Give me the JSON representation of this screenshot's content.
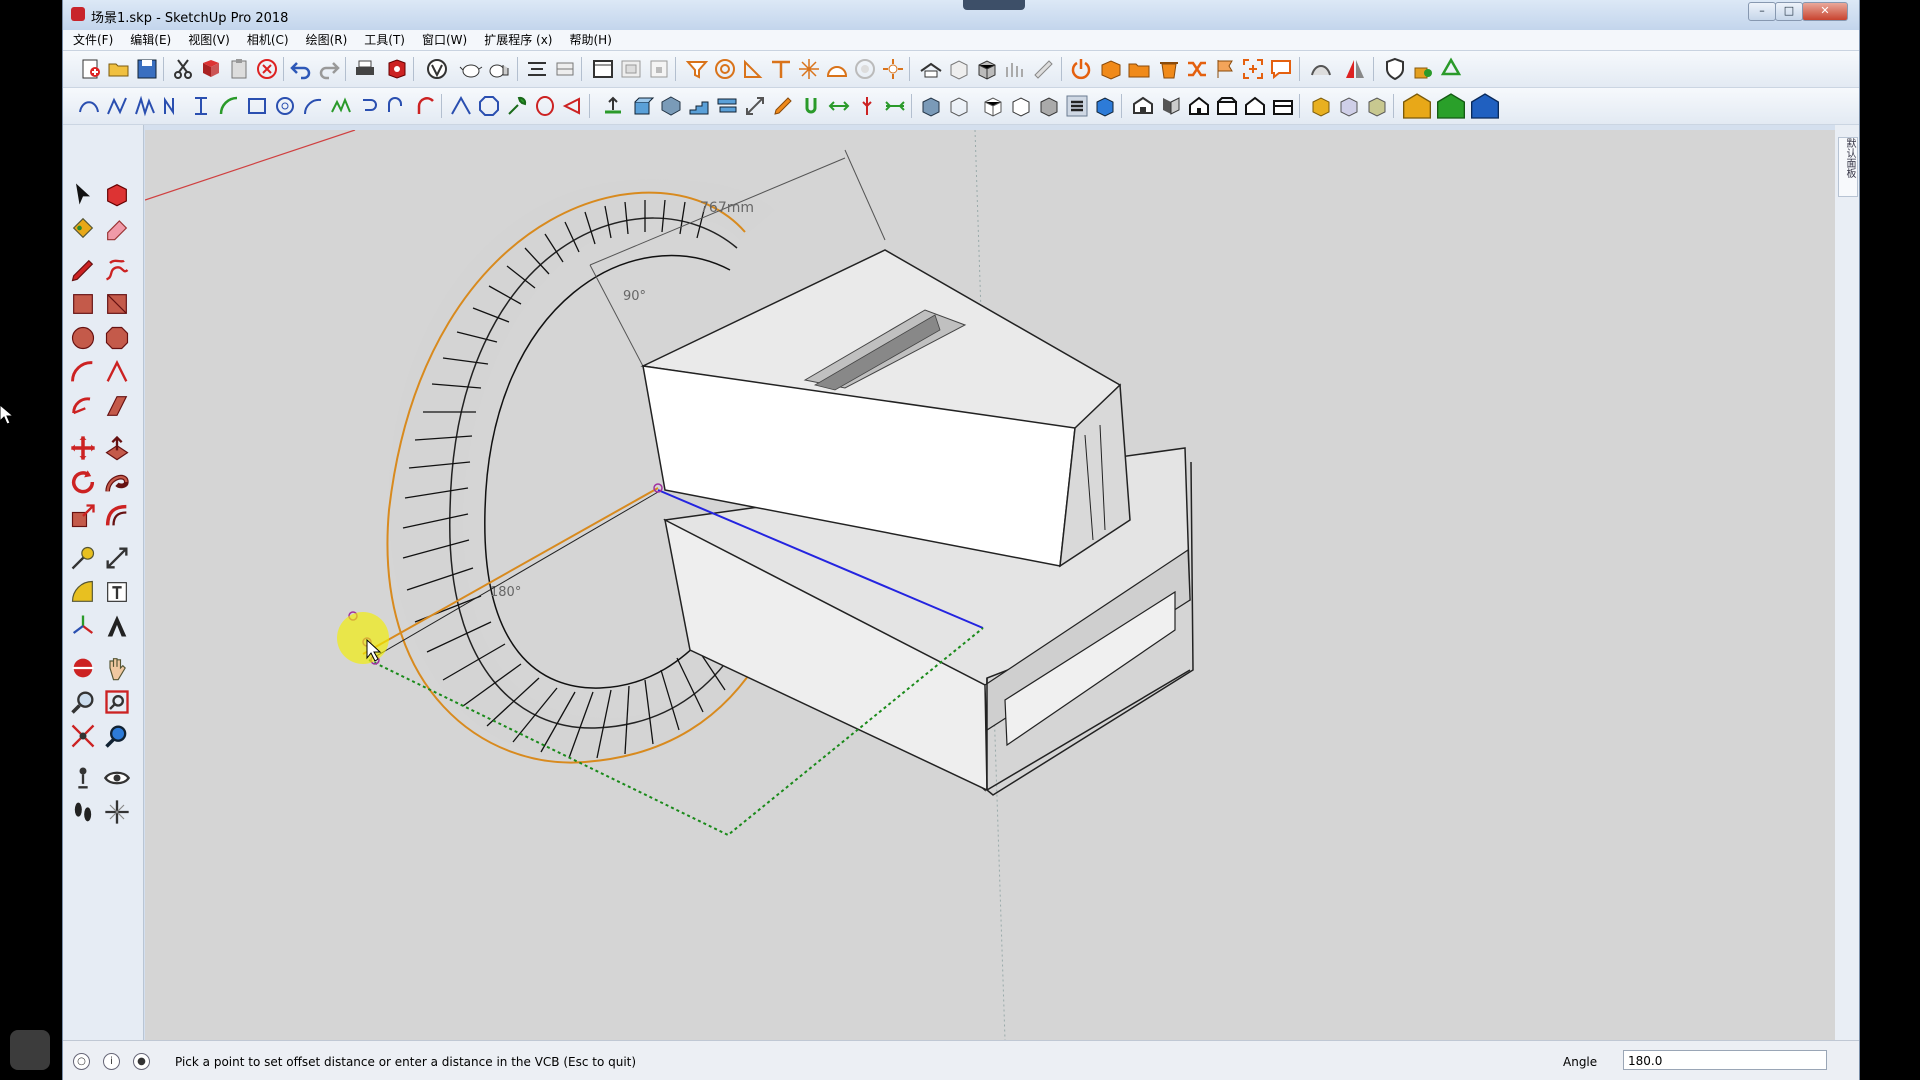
{
  "window": {
    "title": "场景1.skp - SketchUp Pro 2018"
  },
  "menu": [
    "文件(F)",
    "编辑(E)",
    "视图(V)",
    "相机(C)",
    "绘图(R)",
    "工具(T)",
    "窗口(W)",
    "扩展程序 (x)",
    "帮助(H)"
  ],
  "viewport": {
    "labels": {
      "dimension": "767mm",
      "angle_top": "90°",
      "angle_side": "180°"
    }
  },
  "right_panel": {
    "tab_label": "默认面板"
  },
  "status": {
    "message": "Pick a point to set offset distance or enter a distance in the VCB (Esc to quit)",
    "vcb_label": "Angle",
    "vcb_value": "180.0"
  },
  "colors": {
    "accent_orange": "#d88a1e",
    "axis_blue": "#2424e0",
    "axis_green": "#1a8a1a",
    "axis_red": "#d04040",
    "viewport_bg": "#d5d5d5"
  }
}
